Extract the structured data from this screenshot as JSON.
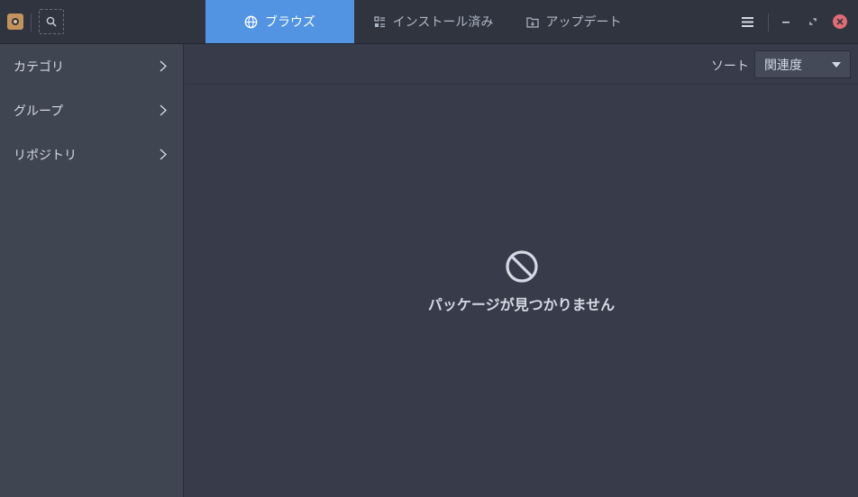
{
  "header": {
    "tabs": [
      {
        "label": "ブラウズ",
        "icon": "globe-icon",
        "active": true
      },
      {
        "label": "インストール済み",
        "icon": "installed-list-icon",
        "active": false
      },
      {
        "label": "アップデート",
        "icon": "updates-folder-icon",
        "active": false
      }
    ]
  },
  "sidebar": {
    "items": [
      {
        "label": "カテゴリ"
      },
      {
        "label": "グループ"
      },
      {
        "label": "リポジトリ"
      }
    ]
  },
  "toolbar": {
    "sort_label": "ソート",
    "sort_value": "関連度"
  },
  "empty_state": {
    "message": "パッケージが見つかりません"
  },
  "colors": {
    "accent": "#5294e2",
    "header_bg": "#2f343f",
    "sidebar_bg": "#404552",
    "main_bg": "#383c4a",
    "close_button": "#e06c75"
  }
}
